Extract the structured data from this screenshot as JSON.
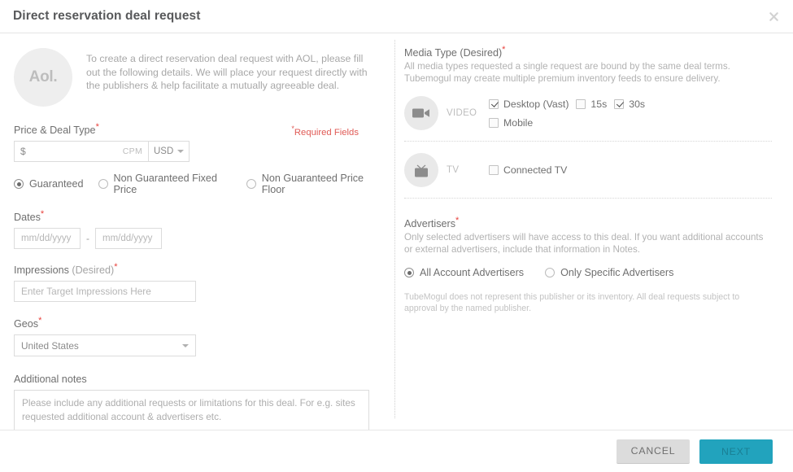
{
  "header": {
    "title": "Direct reservation deal request",
    "close_icon": "close-icon"
  },
  "intro": {
    "logo_text": "Aol.",
    "description": "To create a direct reservation deal request with AOL, please fill out the following details. We will place your request directly with the publishers & help facilitate a mutually agreeable deal."
  },
  "left": {
    "required_note": "Required Fields",
    "required_star": "*",
    "price": {
      "label": "Price & Deal Type",
      "currency_symbol": "$",
      "value": "",
      "unit": "CPM",
      "currency": "USD",
      "deal_types": [
        {
          "label": "Guaranteed",
          "selected": true
        },
        {
          "label": "Non Guaranteed Fixed Price",
          "selected": false
        },
        {
          "label": "Non Guaranteed Price Floor",
          "selected": false
        }
      ]
    },
    "dates": {
      "label": "Dates",
      "start_placeholder": "mm/dd/yyyy",
      "end_placeholder": "mm/dd/yyyy",
      "separator": "-"
    },
    "impressions": {
      "label": "Impressions",
      "label_sub": "(Desired)",
      "placeholder": "Enter Target Impressions Here"
    },
    "geos": {
      "label": "Geos",
      "value": "United States"
    },
    "notes": {
      "label": "Additional notes",
      "placeholder": "Please include any additional requests or limitations for this deal. For e.g. sites requested additional account & advertisers etc."
    }
  },
  "right": {
    "media_type": {
      "title": "Media Type (Desired)",
      "description": "All media types requested a single request are bound by the same deal terms. Tubemogul may create multiple premium inventory feeds to ensure delivery.",
      "rows": [
        {
          "icon": "video-camera-icon",
          "name": "VIDEO",
          "lines": [
            [
              {
                "label": "Desktop (Vast)",
                "checked": true
              },
              {
                "label": "15s",
                "checked": false
              },
              {
                "label": "30s",
                "checked": true
              }
            ],
            [
              {
                "label": "Mobile",
                "checked": false
              }
            ]
          ]
        },
        {
          "icon": "television-icon",
          "name": "TV",
          "lines": [
            [
              {
                "label": "Connected TV",
                "checked": false
              }
            ]
          ]
        }
      ]
    },
    "advertisers": {
      "title": "Advertisers",
      "description": "Only selected advertisers will have access to this deal. If you want additional accounts or external advertisers, include that information in Notes.",
      "options": [
        {
          "label": "All Account Advertisers",
          "selected": true
        },
        {
          "label": "Only Specific Advertisers",
          "selected": false
        }
      ],
      "disclaimer": "TubeMogul does not represent this publisher or its inventory. All deal requests subject to approval by the named publisher."
    }
  },
  "footer": {
    "cancel_label": "CANCEL",
    "next_label": "NEXT"
  },
  "colors": {
    "accent": "#22a3bd",
    "required": "#e8413c",
    "text": "#6f6f6f",
    "muted": "#b2b2b2"
  }
}
